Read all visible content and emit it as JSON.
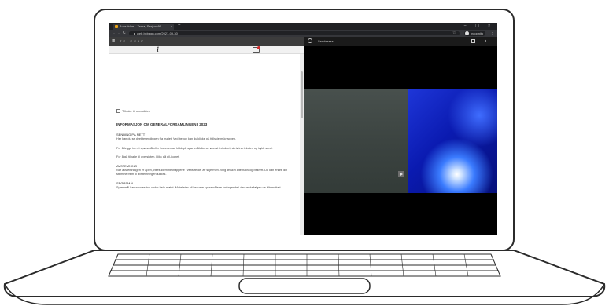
{
  "browser": {
    "tab_title": "Aure tidne – Tema, Sesjon 46",
    "tab_close": "×",
    "new_tab": "+",
    "window_controls": "–  ▢  ×",
    "nav": {
      "back": "←",
      "forward": "→",
      "reload": "C"
    },
    "url": "web.bcbagn.com/2021-09-30",
    "bookmark": "☆",
    "profile_label": "Incognito",
    "menu": "⋮"
  },
  "left_pane": {
    "header_title": "T E L E S A K",
    "menu_icon": "≡",
    "info_icon": "i",
    "back_link": "Tilbake til oversikten",
    "document_title": "INFORMASJON OM GENERALFORSAMLINGEN I 2023",
    "sections": [
      {
        "heading": "SENDING PÅ NETT",
        "paragraphs": [
          "Her kan du se direktesendingen fra møtet. Ved behov kan du klikke på fullskjerm-knappen.",
          "For å legge inn et spørsmål eller kommentar, klikk på spørsmålsikonet øverst i vinduet, skriv inn teksten og trykk send.",
          "For å gå tilbake til oversikten, klikk på pil-ikonet."
        ]
      },
      {
        "heading": "AVSTEMNING",
        "paragraphs": [
          "Når avstemningen er åpen, vises stemmeknappene i venstre del av skjermen. Velg ønsket alternativ og bekreft. Du kan endre din stemme frem til avstemningen lukkes."
        ]
      },
      {
        "heading": "SPØRSMÅL",
        "paragraphs": [
          "Spørsmål kan sendes inn under hele møtet. Møteleder vil besvare spørsmålene fortløpende i den rekkefølgen de blir mottatt."
        ]
      }
    ]
  },
  "right_pane": {
    "header_title": "Sendesess",
    "next_icon": "›"
  }
}
